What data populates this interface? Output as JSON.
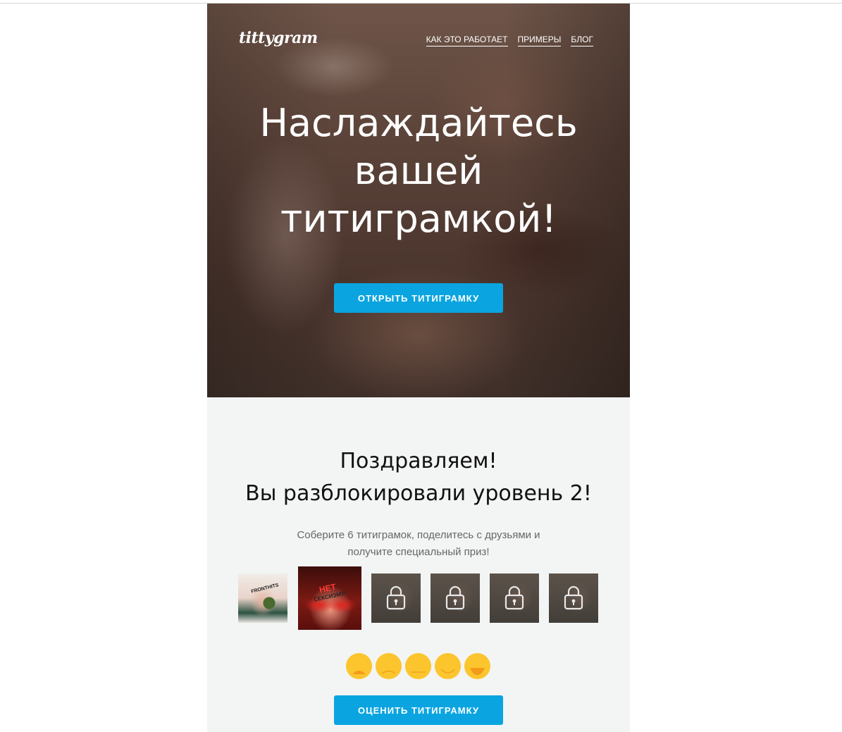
{
  "brand": {
    "logo": "tittygram"
  },
  "nav": {
    "items": [
      "КАК ЭТО РАБОТАЕТ",
      "ПРИМЕРЫ",
      "БЛОГ"
    ]
  },
  "hero": {
    "title_line1": "Наслаждайтесь",
    "title_line2": "вашей",
    "title_line3": "титиграмкой!",
    "cta": "ОТКРЫТЬ ТИТИГРАМКУ"
  },
  "level": {
    "title_line1": "Поздравляем!",
    "title_line2": "Вы разблокировали уровень 2!",
    "subtitle_line1": "Соберите 6 титиграмок, поделитесь с друзьями и",
    "subtitle_line2": "получите специальный приз!",
    "photos": [
      {
        "state": "unlocked",
        "caption": "FRONTHITS"
      },
      {
        "state": "unlocked",
        "caption_line1": "НЕТ",
        "caption_line2": "СЕКСИЗМУ!"
      },
      {
        "state": "locked",
        "icon": "lock-icon"
      },
      {
        "state": "locked",
        "icon": "lock-icon"
      },
      {
        "state": "locked",
        "icon": "lock-icon"
      },
      {
        "state": "locked",
        "icon": "lock-icon"
      }
    ],
    "ratings": [
      "very-sad-face-icon",
      "sad-face-icon",
      "neutral-face-icon",
      "smile-face-icon",
      "laugh-face-icon"
    ],
    "rate_cta": "ОЦЕНИТЬ ТИТИГРАМКУ"
  },
  "colors": {
    "accent": "#0aa5e0",
    "rating": "#fcc52d",
    "section_bg": "#f3f5f4"
  }
}
